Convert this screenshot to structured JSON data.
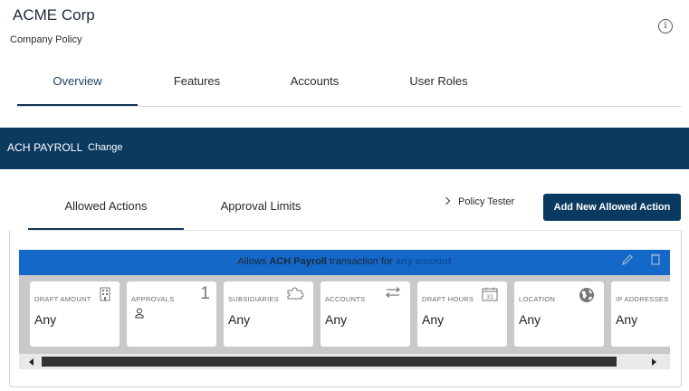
{
  "header": {
    "company_name": "ACME Corp",
    "subtitle": "Company Policy",
    "info_glyph": "i"
  },
  "main_tabs": [
    {
      "label": "Overview",
      "active": true
    },
    {
      "label": "Features",
      "active": false
    },
    {
      "label": "Accounts",
      "active": false
    },
    {
      "label": "User Roles",
      "active": false
    }
  ],
  "feature_bar": {
    "title": "ACH PAYROLL",
    "change_label": "Change",
    "color": "#0b3a60"
  },
  "sub_tabs": [
    {
      "label": "Allowed Actions",
      "active": true
    },
    {
      "label": "Approval Limits",
      "active": false
    }
  ],
  "policy_tester_label": "Policy Tester",
  "add_button_label": "Add New Allowed Action",
  "rule": {
    "prefix": "Allows",
    "transaction": "ACH Payroll",
    "middle": "transaction for",
    "amount": "any amount",
    "header_color": "#1468c8",
    "actions": [
      "edit-icon",
      "trash-icon"
    ]
  },
  "cards": [
    {
      "label": "DRAFT AMOUNT",
      "value": "Any",
      "icon": "building-icon"
    },
    {
      "label": "APPROVALS",
      "count": "1",
      "icon": "person-icon"
    },
    {
      "label": "SUBSIDIARIES",
      "value": "Any",
      "icon": "puzzle-icon"
    },
    {
      "label": "ACCOUNTS",
      "value": "Any",
      "icon": "transfer-arrows-icon"
    },
    {
      "label": "DRAFT HOURS",
      "value": "Any",
      "icon": "calendar-icon",
      "icon_text": "31"
    },
    {
      "label": "LOCATION",
      "value": "Any",
      "icon": "globe-icon"
    },
    {
      "label": "IP ADDRESSES",
      "value": "Any",
      "icon": ""
    }
  ]
}
